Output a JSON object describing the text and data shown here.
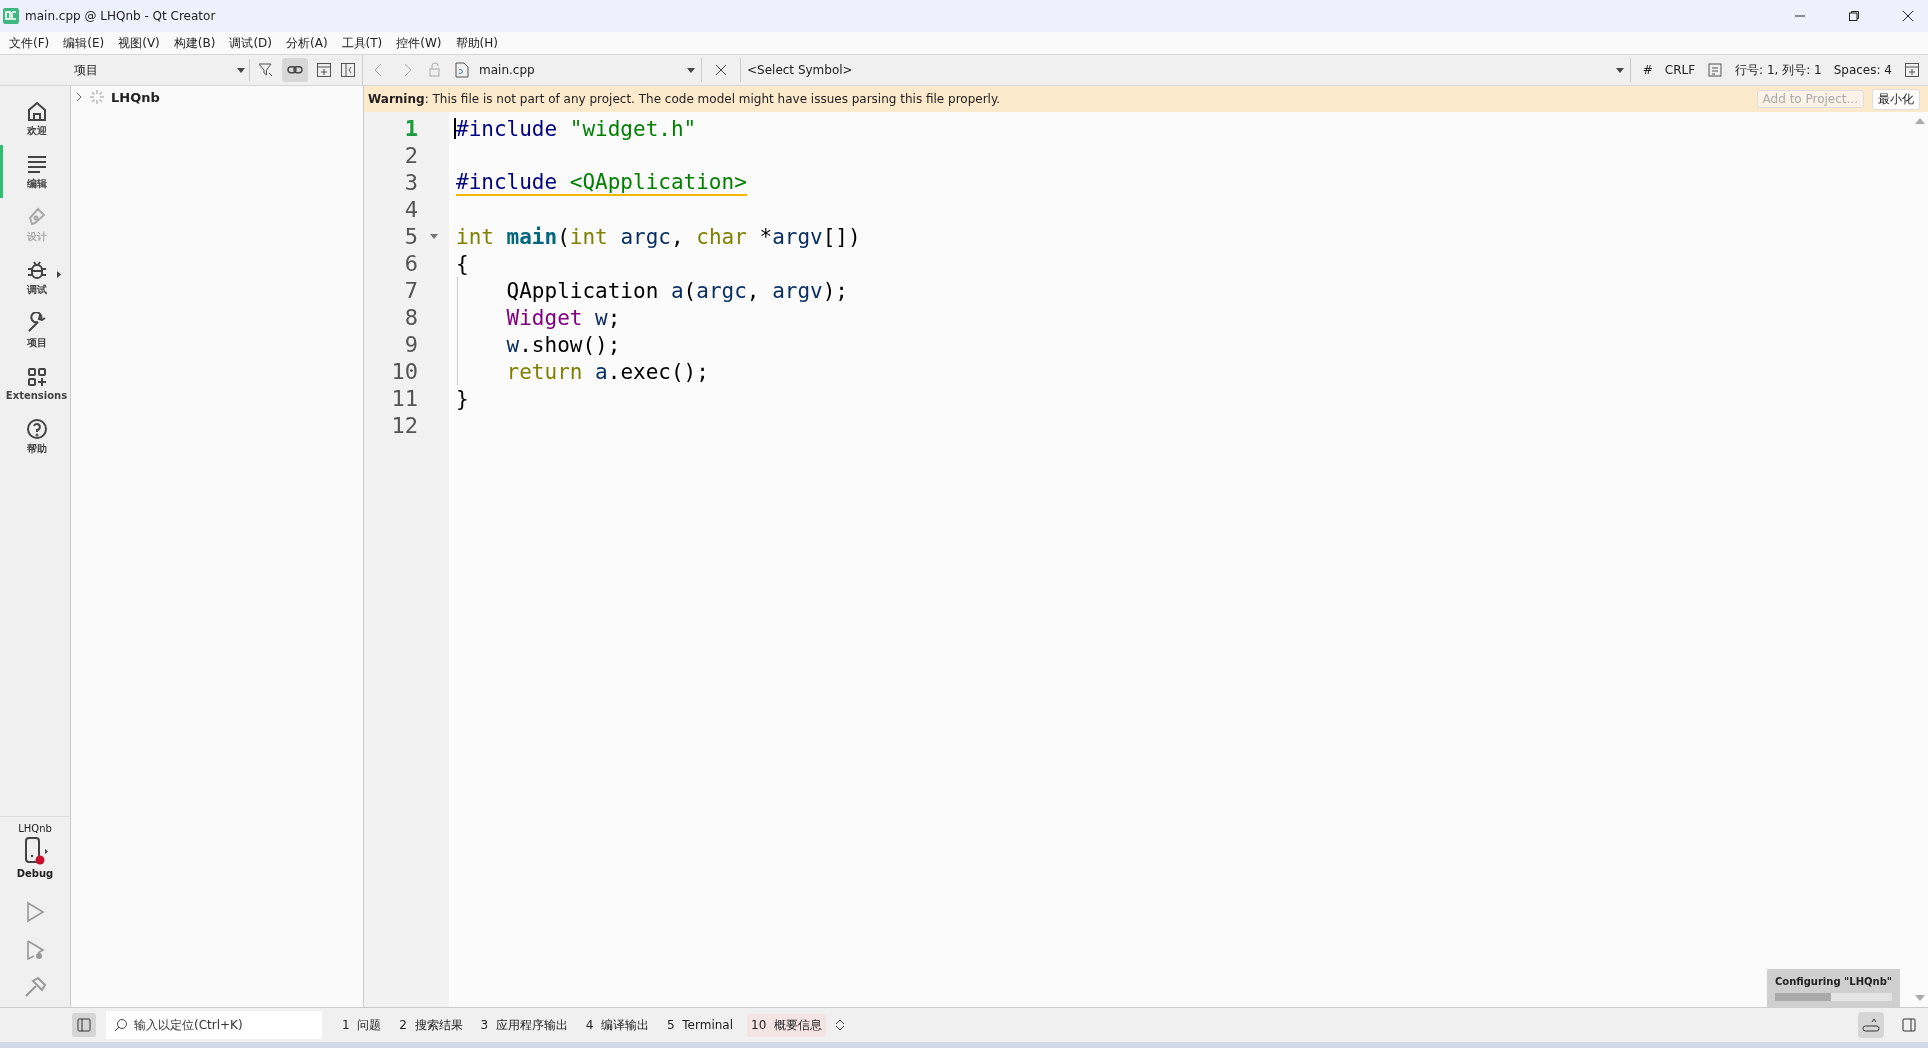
{
  "window": {
    "title": "main.cpp @ LHQnb - Qt Creator"
  },
  "menu": [
    "文件(F)",
    "编辑(E)",
    "视图(V)",
    "构建(B)",
    "调试(D)",
    "分析(A)",
    "工具(T)",
    "控件(W)",
    "帮助(H)"
  ],
  "modes": [
    {
      "label": "欢迎",
      "kind": "home",
      "selected": false,
      "disabled": false,
      "submenu": false
    },
    {
      "label": "编辑",
      "kind": "edit",
      "selected": true,
      "disabled": false,
      "submenu": false
    },
    {
      "label": "设计",
      "kind": "design",
      "selected": false,
      "disabled": true,
      "submenu": false
    },
    {
      "label": "调试",
      "kind": "debug",
      "selected": false,
      "disabled": false,
      "submenu": true
    },
    {
      "label": "项目",
      "kind": "project",
      "selected": false,
      "disabled": false,
      "submenu": false
    },
    {
      "label": "Extensions",
      "kind": "extensions",
      "selected": false,
      "disabled": false,
      "submenu": false
    },
    {
      "label": "帮助",
      "kind": "help",
      "selected": false,
      "disabled": false,
      "submenu": false
    }
  ],
  "kit": {
    "project": "LHQnb",
    "build": "Debug"
  },
  "project_panel": {
    "view": "项目",
    "link_on": true,
    "tree": [
      {
        "label": "LHQnb",
        "expanded": false
      }
    ]
  },
  "editor_toolbar": {
    "file": "main.cpp",
    "symbol": "<Select Symbol>",
    "hash": "#",
    "line_ending": "CRLF",
    "position": "行号: 1, 列号: 1",
    "indent": "Spaces: 4"
  },
  "warning": {
    "text": "**Warning**: This file is not part of any project. The code model might have issues parsing this file properly.",
    "buttons": [
      {
        "label": "Add to Project...",
        "disabled": true
      },
      {
        "label": "最小化",
        "disabled": false
      }
    ]
  },
  "code": [
    {
      "number": "1",
      "current": true,
      "warning": false,
      "tokens": [
        {
          "t": "#include ",
          "kind": "pre"
        },
        {
          "t": "\"widget.h\"",
          "kind": "str"
        }
      ]
    },
    {
      "number": "2",
      "current": false
    },
    {
      "number": "3",
      "current": false,
      "warning": true,
      "tokens": [
        {
          "t": "#include ",
          "kind": "pre"
        },
        {
          "t": "<QApplication>",
          "kind": "str"
        }
      ]
    },
    {
      "number": "4",
      "current": false
    },
    {
      "number": "5",
      "current": false,
      "foldable": true,
      "warning": false,
      "tokens": [
        {
          "t": "int ",
          "kind": "kw"
        },
        {
          "t": "main",
          "kind": "fn"
        },
        {
          "t": "(",
          "kind": "plain"
        },
        {
          "t": "int ",
          "kind": "kw"
        },
        {
          "t": "argc",
          "kind": "param"
        },
        {
          "t": ", ",
          "kind": "plain"
        },
        {
          "t": "char ",
          "kind": "kw"
        },
        {
          "t": "*",
          "kind": "plain"
        },
        {
          "t": "argv",
          "kind": "param"
        },
        {
          "t": "[])",
          "kind": "plain"
        }
      ]
    },
    {
      "number": "6",
      "current": false,
      "warning": false,
      "tokens": [
        {
          "t": "{",
          "kind": "plain"
        }
      ],
      "children": [
        {
          "number": "7",
          "current": false,
          "warning": false,
          "tokens": [
            {
              "t": "QApplication ",
              "kind": "plain"
            },
            {
              "t": "a",
              "kind": "local"
            },
            {
              "t": "(",
              "kind": "plain"
            },
            {
              "t": "argc",
              "kind": "param"
            },
            {
              "t": ", ",
              "kind": "plain"
            },
            {
              "t": "argv",
              "kind": "param"
            },
            {
              "t": ");",
              "kind": "plain"
            }
          ]
        },
        {
          "number": "8",
          "current": false,
          "warning": false,
          "tokens": [
            {
              "t": "Widget ",
              "kind": "type"
            },
            {
              "t": "w",
              "kind": "local"
            },
            {
              "t": ";",
              "kind": "plain"
            }
          ]
        },
        {
          "number": "9",
          "current": false,
          "warning": false,
          "tokens": [
            {
              "t": "w",
              "kind": "local"
            },
            {
              "t": ".show();",
              "kind": "plain"
            }
          ]
        },
        {
          "number": "10",
          "current": false,
          "warning": false,
          "tokens": [
            {
              "t": "return ",
              "kind": "kw"
            },
            {
              "t": "a",
              "kind": "local"
            },
            {
              "t": ".exec();",
              "kind": "plain"
            }
          ]
        }
      ]
    },
    {
      "number": "11",
      "current": false,
      "warning": false,
      "tokens": [
        {
          "t": "}",
          "kind": "plain"
        }
      ]
    },
    {
      "number": "12",
      "current": false
    }
  ],
  "progress": {
    "label": "Configuring \"LHQnb\"",
    "level": 0.48
  },
  "status_bar": {
    "locator_placeholder": "输入以定位(Ctrl+K)",
    "panes": [
      {
        "number": "1",
        "label": "问题",
        "selected": false
      },
      {
        "number": "2",
        "label": "搜索结果",
        "selected": false
      },
      {
        "number": "3",
        "label": "应用程序输出",
        "selected": false
      },
      {
        "number": "4",
        "label": "编译输出",
        "selected": false
      },
      {
        "number": "5",
        "label": "Terminal",
        "selected": false
      },
      {
        "number": "10",
        "label": "概要信息",
        "selected": true
      }
    ]
  }
}
